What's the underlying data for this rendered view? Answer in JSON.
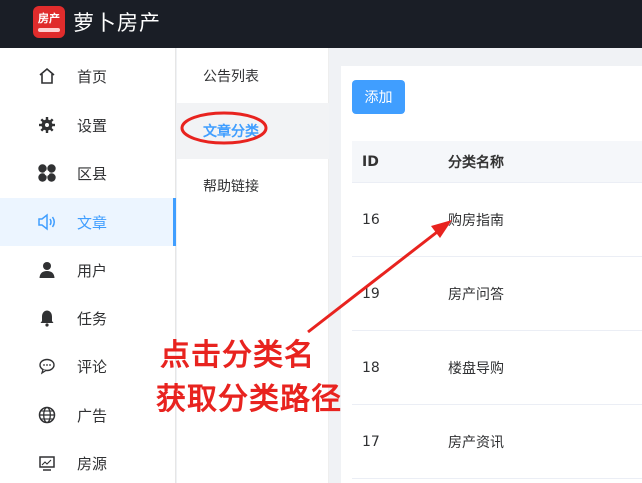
{
  "header": {
    "logo_text": "房产",
    "title": "萝卜房产"
  },
  "sidebar": {
    "items": [
      {
        "label": "首页",
        "icon": "home-icon"
      },
      {
        "label": "设置",
        "icon": "gear-icon"
      },
      {
        "label": "区县",
        "icon": "grid-icon"
      },
      {
        "label": "文章",
        "icon": "speaker-icon",
        "active": true
      },
      {
        "label": "用户",
        "icon": "user-icon"
      },
      {
        "label": "任务",
        "icon": "bell-icon"
      },
      {
        "label": "评论",
        "icon": "comment-icon"
      },
      {
        "label": "广告",
        "icon": "globe-icon"
      },
      {
        "label": "房源",
        "icon": "monitor-icon"
      }
    ]
  },
  "submenu": {
    "items": [
      {
        "label": "公告列表"
      },
      {
        "label": "文章分类",
        "active": true
      },
      {
        "label": "帮助链接"
      }
    ]
  },
  "toolbar": {
    "add_label": "添加"
  },
  "table": {
    "columns": [
      "ID",
      "分类名称"
    ],
    "rows": [
      {
        "id": "16",
        "name": "购房指南"
      },
      {
        "id": "19",
        "name": "房产问答"
      },
      {
        "id": "18",
        "name": "楼盘导购"
      },
      {
        "id": "17",
        "name": "房产资讯"
      }
    ]
  },
  "annotation": {
    "line1": "点击分类名",
    "line2": "获取分类路径",
    "color": "#e8231f"
  },
  "colors": {
    "accent": "#409eff",
    "topbar": "#1a1e26",
    "logo": "#e02c2c"
  }
}
